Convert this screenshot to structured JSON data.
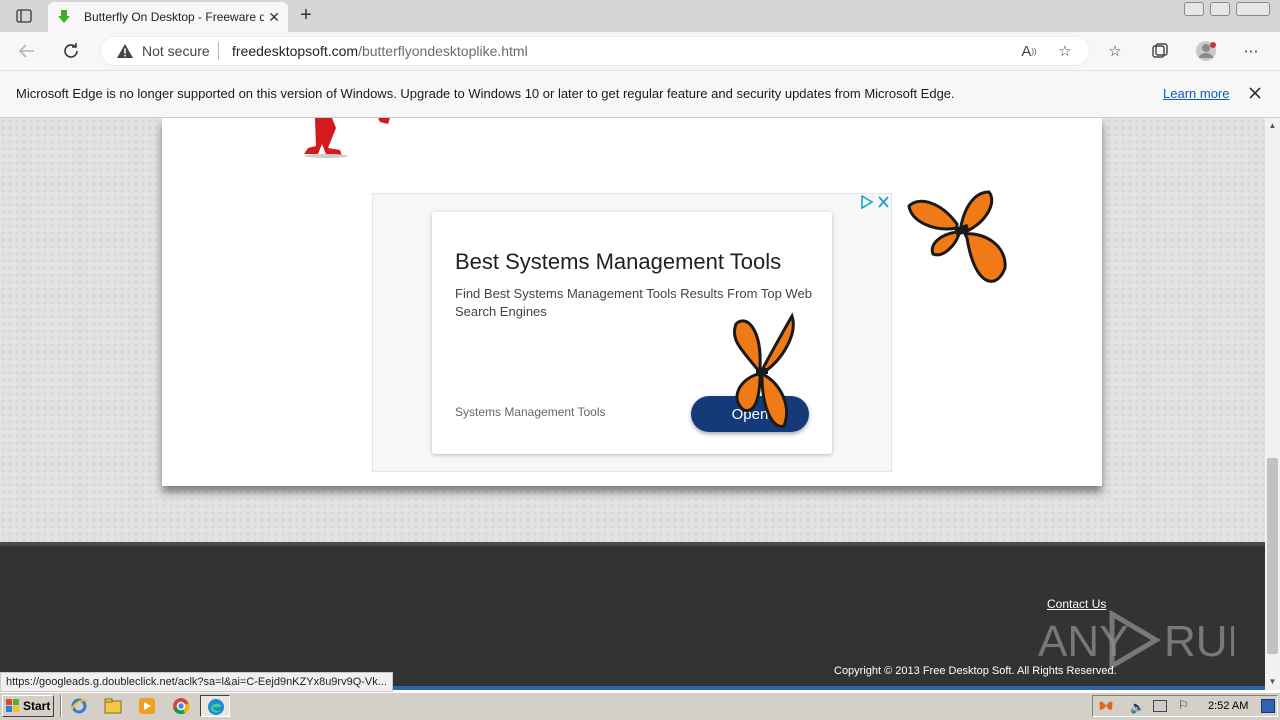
{
  "browser": {
    "tab": {
      "title": "Butterfly On Desktop - Freeware download"
    },
    "address": {
      "security_label": "Not secure",
      "url_host": "freedesktopsoft.com",
      "url_path": "/butterflyondesktoplike.html"
    },
    "infobar": {
      "message": "Microsoft Edge is no longer supported on this version of Windows. Upgrade to Windows 10 or later to get regular feature and security updates from Microsoft Edge.",
      "link_label": "Learn more"
    },
    "status_url": "https://googleads.g.doubleclick.net/aclk?sa=l&ai=C-Eejd9nKZYx8u9rv9Q-Vk..."
  },
  "ad": {
    "title": "Best Systems Management Tools",
    "description": "Find Best Systems Management Tools Results From Top Web Search Engines",
    "brand": "Systems Management Tools",
    "button_label": "Open"
  },
  "footer": {
    "contact_label": "Contact Us",
    "copyright": "Copyright © 2013 Free Desktop Soft. All Rights Reserved."
  },
  "watermark": {
    "left": "ANY",
    "right": "RUN"
  },
  "taskbar": {
    "start_label": "Start",
    "clock": "2:52 AM"
  },
  "colors": {
    "accent_link": "#0f5db5",
    "ad_button": "#143a7a",
    "butterfly_orange": "#f07b16"
  }
}
